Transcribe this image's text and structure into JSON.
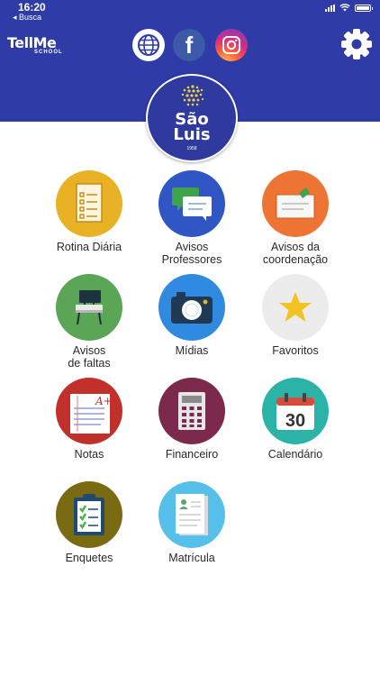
{
  "status_bar": {
    "time": "16:20",
    "back_label": "◂ Busca"
  },
  "header": {
    "brand_title": "TellMe",
    "brand_subtitle": "SCHOOL",
    "social_links": [
      "globe-icon",
      "facebook-icon",
      "instagram-icon"
    ],
    "facebook_glyph": "f",
    "settings_icon": "gear-icon",
    "colors": {
      "header_bg": "#2f3ba6"
    }
  },
  "school_logo": {
    "name_line1": "São",
    "name_line2": "Luis",
    "year": "1958"
  },
  "menu": {
    "items": [
      {
        "label": "Rotina Diária",
        "icon": "checklist-icon",
        "color": "#e8b224"
      },
      {
        "label": "Avisos\nProfessores",
        "icon": "chat-bubbles-icon",
        "color": "#2f56c4"
      },
      {
        "label": "Avisos da\ncoordenação",
        "icon": "note-pin-icon",
        "color": "#ee7433"
      },
      {
        "label": "Avisos\nde faltas",
        "icon": "empty-desk-icon",
        "color": "#5aa556"
      },
      {
        "label": "Mídias",
        "icon": "camera-icon",
        "color": "#2f8ae0"
      },
      {
        "label": "Favoritos",
        "icon": "star-icon",
        "color": "#ececec"
      },
      {
        "label": "Notas",
        "icon": "graded-paper-icon",
        "color": "#c1302b"
      },
      {
        "label": "Financeiro",
        "icon": "calculator-icon",
        "color": "#7b2a4d"
      },
      {
        "label": "Calendário",
        "icon": "calendar-icon",
        "color": "#2ab3a6"
      },
      {
        "label": "Enquetes",
        "icon": "survey-clipboard-icon",
        "color": "#7a6a12"
      },
      {
        "label": "Matrícula",
        "icon": "enrollment-form-icon",
        "color": "#56c0ea"
      }
    ],
    "calendar_day": "30",
    "grade_mark": "A+"
  }
}
